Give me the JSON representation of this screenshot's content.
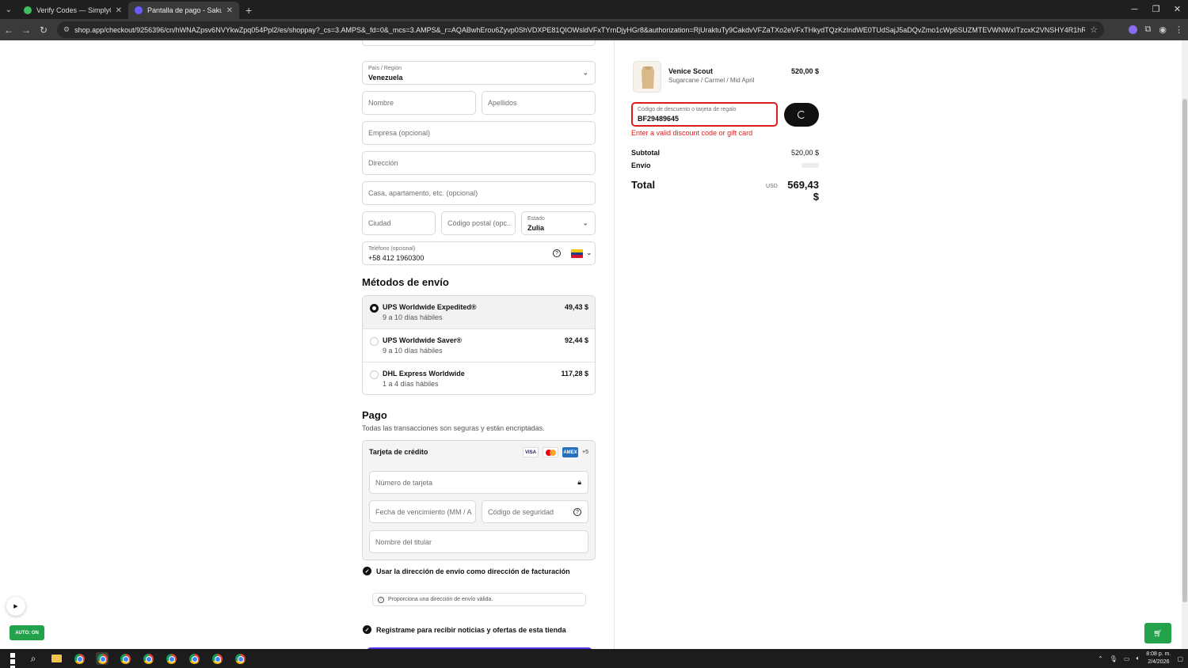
{
  "browser": {
    "tabs": [
      {
        "title": "Verify Codes — SimplyCodes",
        "active": false,
        "favicon_color": "#3fbf5f"
      },
      {
        "title": "Pantalla de pago - Sakura Bloo",
        "active": true,
        "favicon_color": "#6b5cff"
      }
    ],
    "url": "shop.app/checkout/9256396/cn/hWNAZpsv6NVYkwZpq054Ppl2/es/shoppay?_cs=3.AMPS&_fd=0&_mcs=3.AMPS&_r=AQABwhEroυ6Zyvp0ShVDXPE81QIOWsldVFxTYrnDjyHGr8&authorization=RjUraktuTy9CakdvVFZaTXo2eVFxTHkydTQzKzIndWE0TUdSajJ5aDQvZmo1cWp6SUZMTEVWNWxITzcxK2VNSHY4R1hRdStZU285WG5TdzVvU2tGcHlKRDNiG1Z..."
  },
  "shipping_form": {
    "country": {
      "label": "País / Región",
      "value": "Venezuela"
    },
    "first_name_placeholder": "Nombre",
    "last_name_placeholder": "Apellidos",
    "company_placeholder": "Empresa (opcional)",
    "address_placeholder": "Dirección",
    "apartment_placeholder": "Casa, apartamento, etc. (opcional)",
    "city_placeholder": "Ciudad",
    "postal_placeholder": "Código postal (opc...",
    "state": {
      "label": "Estado",
      "value": "Zulia"
    },
    "phone": {
      "label": "Teléfono (opcional)",
      "value": "+58 412 1960300"
    }
  },
  "shipping_methods": {
    "title": "Métodos de envío",
    "options": [
      {
        "name": "UPS Worldwide Expedited®",
        "days": "9 a 10 días hábiles",
        "price": "49,43 $",
        "selected": true
      },
      {
        "name": "UPS Worldwide Saver®",
        "days": "9 a 10 días hábiles",
        "price": "92,44 $",
        "selected": false
      },
      {
        "name": "DHL Express Worldwide",
        "days": "1 a 4 días hábiles",
        "price": "117,28 $",
        "selected": false
      }
    ]
  },
  "payment": {
    "title": "Pago",
    "subtitle": "Todas las transacciones son seguras y están encriptadas.",
    "method": "Tarjeta de crédito",
    "card_brands": [
      "VISA",
      "AMEX"
    ],
    "more_cards": "+5",
    "card_number_placeholder": "Número de tarjeta",
    "expiry_placeholder": "Fecha de vencimiento (MM / AA)",
    "cvv_placeholder": "Código de seguridad",
    "holder_placeholder": "Nombre del titular",
    "billing_same": "Usar la dirección de envío como dirección de facturación",
    "billing_notice": "Proporciona una dirección de envío válida.",
    "newsletter": "Registrame para recibir noticias y ofertas de esta tienda"
  },
  "summary": {
    "product": {
      "name": "Venice Scout",
      "variant": "Sugarcane / Carmel / Mid April",
      "price": "520,00 $"
    },
    "discount": {
      "label": "Código de descuento o tarjeta de regalo",
      "value": "BF29489645",
      "error": "Enter a valid discount code or gift card"
    },
    "subtotal_label": "Subtotal",
    "subtotal_value": "520,00 $",
    "shipping_label": "Envío",
    "total_label": "Total",
    "total_currency": "USD",
    "total_value": "569,43 $"
  },
  "widgets": {
    "auto_badge": "AUTO: ON"
  },
  "taskbar": {
    "time": "8:08 p. m.",
    "date": "2/4/2026"
  }
}
